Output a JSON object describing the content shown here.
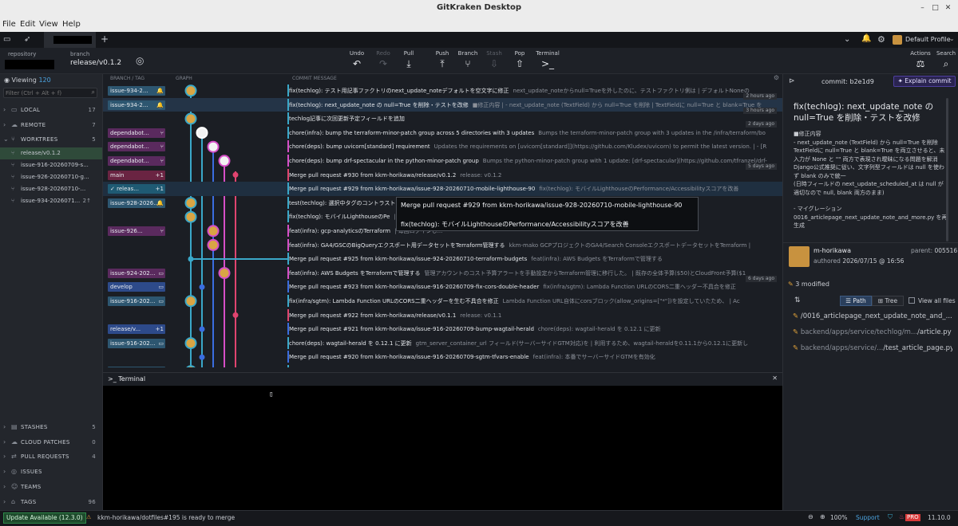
{
  "window_title": "GitKraken Desktop",
  "menu": [
    "File",
    "Edit",
    "View",
    "Help"
  ],
  "profile": "Default Profile",
  "toolbar": {
    "repository_label": "repository",
    "branch_label": "branch",
    "branch_name": "release/v0.1.2",
    "buttons": [
      {
        "label": "Undo",
        "icon": "undo-icon",
        "glyph": "↶",
        "enabled": true
      },
      {
        "label": "Redo",
        "icon": "redo-icon",
        "glyph": "↷",
        "enabled": false
      },
      {
        "label": "Pull",
        "icon": "pull-icon",
        "glyph": "⤓",
        "enabled": true
      },
      {
        "label": "Push",
        "icon": "push-icon",
        "glyph": "⤒",
        "enabled": true
      },
      {
        "label": "Branch",
        "icon": "branch-icon",
        "glyph": "⑂",
        "enabled": true
      },
      {
        "label": "Stash",
        "icon": "stash-icon",
        "glyph": "⇩",
        "enabled": false
      },
      {
        "label": "Pop",
        "icon": "pop-icon",
        "glyph": "⇧",
        "enabled": true
      },
      {
        "label": "Terminal",
        "icon": "terminal-icon",
        "glyph": ">_",
        "enabled": true
      }
    ],
    "actions_label": "Actions",
    "search_label": "Search"
  },
  "sidebar": {
    "viewing_label": "Viewing",
    "viewing_count": "120",
    "filter_placeholder": "Filter (Ctrl + Alt + f)",
    "sections_top": [
      {
        "name": "LOCAL",
        "count": "17",
        "icon": "computer-icon",
        "glyph": "▭"
      },
      {
        "name": "REMOTE",
        "count": "7",
        "icon": "cloud-icon",
        "glyph": "☁"
      },
      {
        "name": "WORKTREES",
        "count": "5",
        "icon": "worktree-icon",
        "glyph": "⑂"
      }
    ],
    "worktrees": [
      {
        "name": "release/v0.1.2",
        "active": true,
        "extra": ""
      },
      {
        "name": "issue-916-20260709-s...",
        "active": false,
        "extra": ""
      },
      {
        "name": "issue-926-20260710-g...",
        "active": false,
        "extra": ""
      },
      {
        "name": "issue-928-20260710-...",
        "active": false,
        "extra": ""
      },
      {
        "name": "issue-934-2026071...",
        "active": false,
        "extra": "2↑"
      }
    ],
    "sections_bottom": [
      {
        "name": "STASHES",
        "count": "5",
        "icon": "stash-icon",
        "glyph": "▤"
      },
      {
        "name": "CLOUD PATCHES",
        "count": "0",
        "icon": "cloud-patch-icon",
        "glyph": "☁"
      },
      {
        "name": "PULL REQUESTS",
        "count": "4",
        "icon": "pull-request-icon",
        "glyph": "⇄"
      },
      {
        "name": "ISSUES",
        "count": "",
        "icon": "issue-icon",
        "glyph": "◎"
      },
      {
        "name": "TEAMS",
        "count": "",
        "icon": "team-icon",
        "glyph": "☺"
      },
      {
        "name": "TAGS",
        "count": "96",
        "icon": "tag-icon",
        "glyph": "⌂"
      }
    ]
  },
  "graph": {
    "headers": [
      "BRANCH / TAG",
      "GRAPH",
      "COMMIT MESSAGE"
    ],
    "rows": [
      {
        "label": "issue-934-2...",
        "lc": "#2d5670",
        "icons": "🔔",
        "msg": "fix(techlog): テスト用記事ファクトリのnext_update_noteデフォルトを空文字に修正",
        "desc": "next_update_noteからnull=Trueを外したのに、テストファクトリ側は | デフォルトNoneの",
        "time": "2 hours ago",
        "strip": "#3aa8c9",
        "dot": 1,
        "dc": "#3aa8c9",
        "av": true
      },
      {
        "label": "issue-934-2...",
        "lc": "#2d5670",
        "icons": "🔔",
        "msg": "fix(techlog): next_update_note の null=True を削除・テストを改修",
        "desc": "■修正内容 | - next_update_note (TextField) から null=True を削除 | TextFieldに null=True と blank=True を",
        "time": "3 hours ago",
        "strip": "#3aa8c9",
        "dot": 1,
        "dc": "#3aa8c9",
        "av": true,
        "sel": true
      },
      {
        "label": "",
        "lc": "",
        "icons": "",
        "msg": "techlog記事に次回更新予定フィールドを追加",
        "desc": "",
        "time": "2 days ago",
        "strip": "#3aa8c9",
        "dot": 1,
        "dc": "#3aa8c9",
        "av": true
      },
      {
        "label": "dependabot...",
        "lc": "#5a2a5e",
        "icons": "⑂",
        "msg": "chore(infra): bump the terraform-minor-patch group across 5 directories with 3 updates",
        "desc": "Bumps the terraform-minor-patch group with 3 updates in the /infra/terraform/bo",
        "time": "",
        "strip": "#3aa8c9",
        "dot": 2,
        "dc": "#ffffff",
        "av": false
      },
      {
        "label": "dependabot...",
        "lc": "#5a2a5e",
        "icons": "⑂",
        "msg": "chore(deps): bump uvicorn[standard] requirement",
        "desc": "Updates the requirements on [uvicorn[standard]](https://github.com/Kludex/uvicorn) to permit the latest version. | - [R",
        "time": "",
        "strip": "#d64ec7",
        "dot": 3,
        "dc": "#d64ec7",
        "av": false
      },
      {
        "label": "dependabot...",
        "lc": "#5a2a5e",
        "icons": "⑂",
        "msg": "chore(deps): bump drf-spectacular in the python-minor-patch group",
        "desc": "Bumps the python-minor-patch group with 1 update: [drf-spectacular](https://github.com/tfranzel/drf-",
        "time": "5 days ago",
        "strip": "#d64ec7",
        "dot": 4,
        "dc": "#d64ec7",
        "av": false
      },
      {
        "label": "main",
        "lc": "#6a2442",
        "icons": "+1",
        "msg": "Merge pull request #930 from kkm-horikawa/release/v0.1.2",
        "desc": "release: v0.1.2",
        "time": "",
        "strip": "#e0446f",
        "dot": 5,
        "dc": "#e0446f",
        "av": false,
        "small": true
      },
      {
        "label": "✓ releas...",
        "lc": "#1f5a73",
        "icons": "+1",
        "msg": "Merge pull request #929 from kkm-horikawa/issue-928-20260710-mobile-lighthouse-90",
        "desc": "fix(techlog): モバイルLighthouseのPerformance/Accessibilityスコアを改善",
        "time": "",
        "strip": "#3aa8c9",
        "dot": 0,
        "dc": "#3aa8c9",
        "av": false,
        "small": true,
        "hov": true
      },
      {
        "label": "issue-928-2026...",
        "lc": "#2d5670",
        "icons": "🔔",
        "msg": "test(techlog): 選択中タグのコントラスト",
        "desc": "...クスを検証するテスト...",
        "time": "",
        "strip": "#3aa8c9",
        "dot": 1,
        "dc": "#3aa8c9",
        "av": true
      },
      {
        "label": "",
        "lc": "",
        "icons": "",
        "msg": "fix(techlog): モバイルLighthouseのPe",
        "desc": "| ブランドカラー・グレ...",
        "time": "",
        "strip": "#3aa8c9",
        "dot": 1,
        "dc": "#3aa8c9",
        "av": true
      },
      {
        "label": "issue-926...",
        "lc": "#5a2a5e",
        "icons": "⑂",
        "msg": "feat(infra): gcp-analyticsのTerraform",
        "desc": "| 毎回ログインし...",
        "time": "",
        "strip": "#d64ec7",
        "dot": 3,
        "dc": "#d64ec7",
        "av": true
      },
      {
        "label": "",
        "lc": "",
        "icons": "",
        "msg": "feat(infra): GA4/GSCのBigQueryエクスポート用データセットをTerraform管理する",
        "desc": "kkm-mako GCPプロジェクトのGA4/Search ConsoleエクスポートデータセットをTerraform |",
        "time": "",
        "strip": "#d64ec7",
        "dot": 3,
        "dc": "#d64ec7",
        "av": true
      },
      {
        "label": "",
        "lc": "",
        "icons": "",
        "msg": "Merge pull request #925 from kkm-horikawa/issue-924-20260710-terraform-budgets",
        "desc": "feat(infra): AWS Budgets をTerraformで管理する",
        "time": "",
        "strip": "#3aa8c9",
        "dot": 0,
        "dc": "#3aa8c9",
        "av": false,
        "small": true
      },
      {
        "label": "issue-924-202...",
        "lc": "#5a2a5e",
        "icons": "▭",
        "msg": "feat(infra): AWS Budgets をTerraformで管理する",
        "desc": "管理アカウントのコスト予算アラートを手動設定からTerraform管理に移行した。 | 既存の全体予算($50)とCloudFront予算($1",
        "time": "6 days ago",
        "strip": "#d64ec7",
        "dot": 4,
        "dc": "#d64ec7",
        "av": true
      },
      {
        "label": "develop",
        "lc": "#2d4a8a",
        "icons": "▭",
        "msg": "Merge pull request #923 from kkm-horikawa/issue-916-20260709-fix-cors-double-header",
        "desc": "fix(infra/sgtm): Lambda Function URLのCORS二重ヘッダー不具合を修正",
        "time": "",
        "strip": "#3a6de0",
        "dot": 2,
        "dc": "#3a6de0",
        "av": false,
        "small": true
      },
      {
        "label": "issue-916-202...",
        "lc": "#2d5670",
        "icons": "▭",
        "msg": "fix(infra/sgtm): Lambda Function URLのCORS二重ヘッダーを生む不具合を修正",
        "desc": "Lambda Function URL自体にcorsブロック(allow_origins=[\"*\"])を設定していたため、 | Ac",
        "time": "",
        "strip": "#3aa8c9",
        "dot": 0,
        "dc": "#3aa8c9",
        "av": true
      },
      {
        "label": "",
        "lc": "",
        "icons": "",
        "msg": "Merge pull request #922 from kkm-horikawa/release/v0.1.1",
        "desc": "release: v0.1.1",
        "time": "",
        "strip": "#e0446f",
        "dot": 5,
        "dc": "#e0446f",
        "av": false,
        "small": true
      },
      {
        "label": "release/v...",
        "lc": "#2d4a8a",
        "icons": "+1",
        "msg": "Merge pull request #921 from kkm-horikawa/issue-916-20260709-bump-wagtail-herald",
        "desc": "chore(deps): wagtail-herald を 0.12.1 に更新",
        "time": "",
        "strip": "#3a6de0",
        "dot": 2,
        "dc": "#3a6de0",
        "av": false,
        "small": true
      },
      {
        "label": "issue-916-202...",
        "lc": "#2d5670",
        "icons": "▭",
        "msg": "chore(deps): wagtail-herald を 0.12.1 に更新",
        "desc": "gtm_server_container_url フィールド(サーバーサイドGTM対応)を | 利用するため、wagtail-heraldを0.11.1から0.12.1に更新し",
        "time": "",
        "strip": "#3aa8c9",
        "dot": 0,
        "dc": "#3aa8c9",
        "av": true
      },
      {
        "label": "",
        "lc": "",
        "icons": "",
        "msg": "Merge pull request #920 from kkm-horikawa/issue-916-20260709-sgtm-tfvars-enable",
        "desc": "feat(infra): 本番でサーバーサイドGTMを有効化",
        "time": "",
        "strip": "#3a6de0",
        "dot": 2,
        "dc": "#3a6de0",
        "av": false,
        "small": true
      },
      {
        "label": "issue-916-202...",
        "lc": "#2d5670",
        "icons": "▭",
        "msg": "feat(infra): 本番でサーバーサイドGTMを有効化",
        "desc": "data.kkm-mako.com のLambda/CloudFront/GTMサーバーコンテナ設定を | production.tfvars に投入し、 sgtm_enabled を tr",
        "time": "",
        "strip": "#3aa8c9",
        "dot": 0,
        "dc": "#3aa8c9",
        "av": true
      }
    ]
  },
  "tooltip": {
    "line1": "Merge pull request #929 from kkm-horikawa/issue-928-20260710-mobile-lighthouse-90",
    "line2": "fix(techlog): モバイルLighthouseのPerformance/Accessibilityスコアを改善"
  },
  "terminal": {
    "title": ">_ Terminal",
    "cursor": "▯"
  },
  "commit_panel": {
    "commit_label": "commit:",
    "commit_sha": "b2e1d9",
    "explain_button": "Explain commit",
    "title": "fix(techlog): next_update_note の null=True を削除・テストを改修",
    "body": [
      "■修正内容",
      "- next_update_note (TextField) から null=True を削除",
      "  TextFieldに null=True と blank=True を両立させると、未入力が None と \"\" 両方で表現され曖昧になる問題を解消",
      "  Django公式推奨に従い、文字列型フィールドは null を使わず blank のみで統一",
      "  (日時フィールドの next_update_scheduled_at は null が適切なので null, blank 両方のまま)",
      "",
      "- マイグレーション 0016_articlepage_next_update_note_and_more.py を再生成"
    ],
    "author": "m-horikawa",
    "authored_label": "authored",
    "authored_date": "2026/07/15 @ 16:56",
    "parent_label": "parent:",
    "parent_sha": "005516",
    "modified_count": "3 modified",
    "path_button": "Path",
    "tree_button": "Tree",
    "view_all_label": "View all files",
    "files": [
      {
        "dir": "",
        "name": "/0016_articlepage_next_update_note_and_..."
      },
      {
        "dir": "backend/apps/service/techlog/m...",
        "name": "/article.py"
      },
      {
        "dir": "backend/apps/service/...",
        "name": "/test_article_page.py"
      }
    ]
  },
  "statusbar": {
    "update": "Update Available (12.3.0)",
    "message": "kkm-horikawa/dotfiles#195 is ready to merge",
    "zoom": "100%",
    "support": "Support",
    "pro": "PRO",
    "version": "11.10.0"
  }
}
